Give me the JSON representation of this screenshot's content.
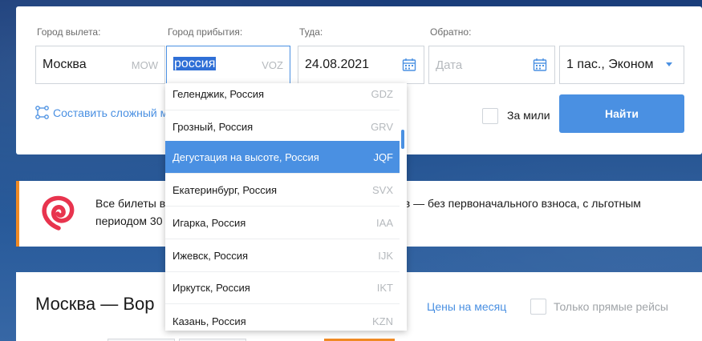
{
  "search": {
    "from_label": "Город вылета:",
    "to_label": "Город прибытия:",
    "depart_label": "Туда:",
    "return_label": "Обратно:",
    "from_value": "Москва",
    "from_code": "MOW",
    "to_value": "россия",
    "to_code": "VOZ",
    "depart_value": "24.08.2021",
    "return_placeholder": "Дата",
    "passengers_value": "1 пас., Эконом",
    "complex_route_link": "Составить сложный м",
    "miles_label": "За мили",
    "find_button": "Найти"
  },
  "promo": {
    "text_line1": "Все билеты в",
    "text_line1_tail": "цев — без первоначального взноса, с льготным",
    "text_line2": "периодом 30"
  },
  "results": {
    "title": "Москва — Вор",
    "month_prices_link": "Цены на месяц",
    "direct_flights_label": "Только прямые рейсы"
  },
  "suggestions": [
    {
      "name": "Геленджик, Россия",
      "code": "GDZ"
    },
    {
      "name": "Грозный, Россия",
      "code": "GRV"
    },
    {
      "name": "Дегустация на высоте, Россия",
      "code": "JQF"
    },
    {
      "name": "Екатеринбург, Россия",
      "code": "SVX"
    },
    {
      "name": "Игарка, Россия",
      "code": "IAA"
    },
    {
      "name": "Ижевск, Россия",
      "code": "IJK"
    },
    {
      "name": "Иркутск, Россия",
      "code": "IKT"
    },
    {
      "name": "Казань, Россия",
      "code": "KZN"
    }
  ],
  "colors": {
    "accent": "#4a90e2",
    "promo_border": "#f08a24",
    "logo_red": "#e8344e"
  },
  "icons": [
    "swap-icon",
    "calendar-icon",
    "route-icon",
    "chevron-down-icon",
    "brand-logo-icon"
  ]
}
